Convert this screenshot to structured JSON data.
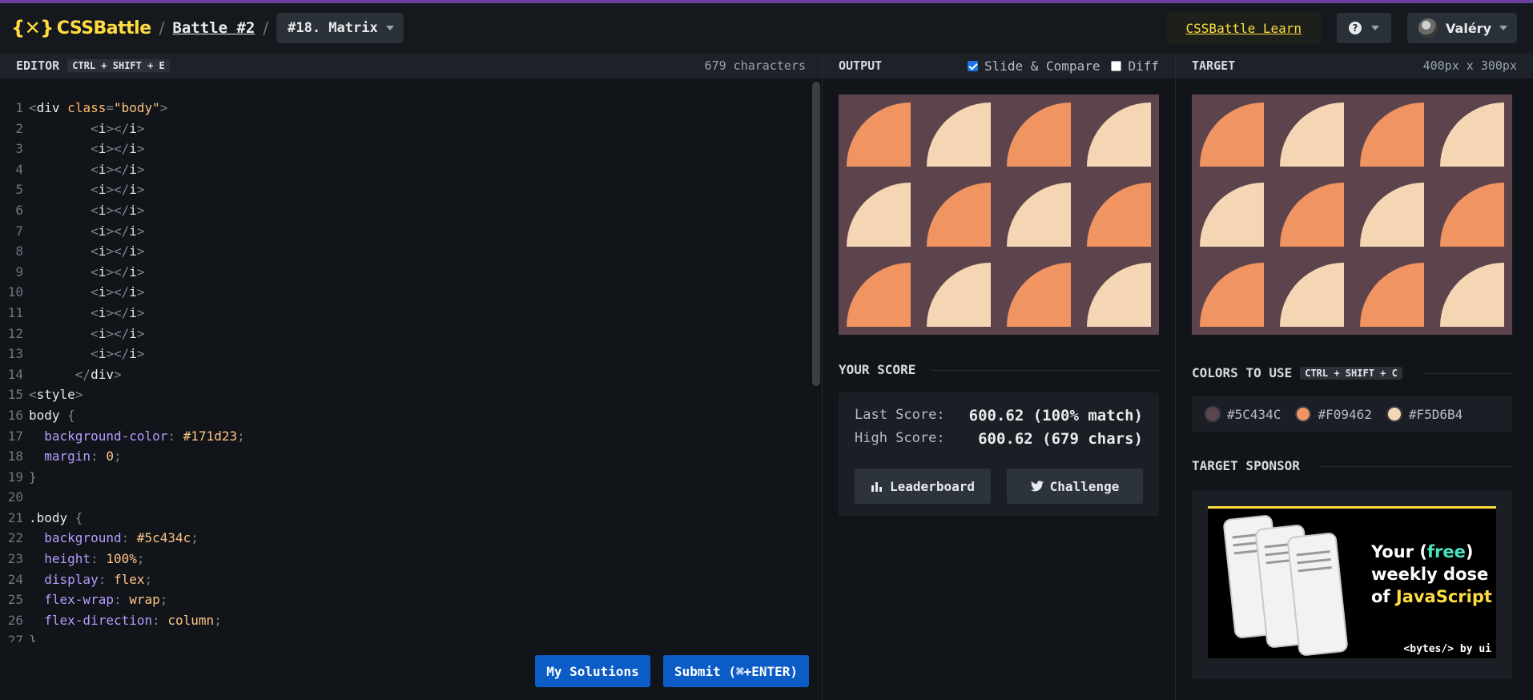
{
  "header": {
    "logo_text": "CSSBattle",
    "logo_glyph": "{✕}",
    "crumb_sep": "/",
    "battle": "Battle #2",
    "target_select": "#18. Matrix",
    "learn": "CSSBattle Learn",
    "help": "?",
    "user": "Valéry"
  },
  "editor": {
    "title": "EDITOR",
    "shortcut": "CTRL + SHIFT + E",
    "char_count": "679 characters",
    "my_solutions": "My Solutions",
    "submit": "Submit (⌘+ENTER)"
  },
  "output": {
    "title": "OUTPUT",
    "slide_compare": "Slide & Compare",
    "slide_compare_checked": true,
    "diff": "Diff",
    "diff_checked": false,
    "score_title": "YOUR SCORE",
    "last_score_label": "Last Score:",
    "last_score_value": "600.62 (100% match)",
    "high_score_label": "High Score:",
    "high_score_value": "600.62 (679 chars)",
    "leaderboard": "Leaderboard",
    "challenge": "Challenge"
  },
  "target": {
    "title": "TARGET",
    "size": "400px x 300px",
    "colors_title": "COLORS TO USE",
    "colors_shortcut": "CTRL + SHIFT + C",
    "colors": [
      {
        "hex": "#5C434C",
        "value": "#5C434C"
      },
      {
        "hex": "#F09462",
        "value": "#F09462"
      },
      {
        "hex": "#F5D6B4",
        "value": "#F5D6B4"
      }
    ],
    "sponsor_title": "TARGET SPONSOR",
    "ad_line1_a": "Your (",
    "ad_line1_free": "free",
    "ad_line1_b": ")",
    "ad_line2": "weekly dose",
    "ad_line3_a": "of ",
    "ad_line3_js": "JavaScript",
    "ad_brand": "<bytes/> by ui"
  },
  "pattern": {
    "background": "#5c434c",
    "orange": "#F09462",
    "cream": "#F5D6B4",
    "rows": [
      [
        "orange",
        "cream",
        "orange",
        "cream"
      ],
      [
        "cream",
        "orange",
        "cream",
        "orange"
      ],
      [
        "orange",
        "cream",
        "orange",
        "cream"
      ]
    ]
  },
  "code_lines": [
    [
      {
        "t": "<",
        "c": "punc"
      },
      {
        "t": "div",
        "c": "tag"
      },
      {
        "t": " class",
        "c": "attr"
      },
      {
        "t": "=",
        "c": "punc"
      },
      {
        "t": "\"body\"",
        "c": "str"
      },
      {
        "t": ">",
        "c": "punc"
      }
    ],
    [
      {
        "t": "        <",
        "c": "punc"
      },
      {
        "t": "i",
        "c": "tag"
      },
      {
        "t": "></",
        "c": "punc"
      },
      {
        "t": "i",
        "c": "tag"
      },
      {
        "t": ">",
        "c": "punc"
      }
    ],
    [
      {
        "t": "        <",
        "c": "punc"
      },
      {
        "t": "i",
        "c": "tag"
      },
      {
        "t": "></",
        "c": "punc"
      },
      {
        "t": "i",
        "c": "tag"
      },
      {
        "t": ">",
        "c": "punc"
      }
    ],
    [
      {
        "t": "        <",
        "c": "punc"
      },
      {
        "t": "i",
        "c": "tag"
      },
      {
        "t": "></",
        "c": "punc"
      },
      {
        "t": "i",
        "c": "tag"
      },
      {
        "t": ">",
        "c": "punc"
      }
    ],
    [
      {
        "t": "        <",
        "c": "punc"
      },
      {
        "t": "i",
        "c": "tag"
      },
      {
        "t": "></",
        "c": "punc"
      },
      {
        "t": "i",
        "c": "tag"
      },
      {
        "t": ">",
        "c": "punc"
      }
    ],
    [
      {
        "t": "        <",
        "c": "punc"
      },
      {
        "t": "i",
        "c": "tag"
      },
      {
        "t": "></",
        "c": "punc"
      },
      {
        "t": "i",
        "c": "tag"
      },
      {
        "t": ">",
        "c": "punc"
      }
    ],
    [
      {
        "t": "        <",
        "c": "punc"
      },
      {
        "t": "i",
        "c": "tag"
      },
      {
        "t": "></",
        "c": "punc"
      },
      {
        "t": "i",
        "c": "tag"
      },
      {
        "t": ">",
        "c": "punc"
      }
    ],
    [
      {
        "t": "        <",
        "c": "punc"
      },
      {
        "t": "i",
        "c": "tag"
      },
      {
        "t": "></",
        "c": "punc"
      },
      {
        "t": "i",
        "c": "tag"
      },
      {
        "t": ">",
        "c": "punc"
      }
    ],
    [
      {
        "t": "        <",
        "c": "punc"
      },
      {
        "t": "i",
        "c": "tag"
      },
      {
        "t": "></",
        "c": "punc"
      },
      {
        "t": "i",
        "c": "tag"
      },
      {
        "t": ">",
        "c": "punc"
      }
    ],
    [
      {
        "t": "        <",
        "c": "punc"
      },
      {
        "t": "i",
        "c": "tag"
      },
      {
        "t": "></",
        "c": "punc"
      },
      {
        "t": "i",
        "c": "tag"
      },
      {
        "t": ">",
        "c": "punc"
      }
    ],
    [
      {
        "t": "        <",
        "c": "punc"
      },
      {
        "t": "i",
        "c": "tag"
      },
      {
        "t": "></",
        "c": "punc"
      },
      {
        "t": "i",
        "c": "tag"
      },
      {
        "t": ">",
        "c": "punc"
      }
    ],
    [
      {
        "t": "        <",
        "c": "punc"
      },
      {
        "t": "i",
        "c": "tag"
      },
      {
        "t": "></",
        "c": "punc"
      },
      {
        "t": "i",
        "c": "tag"
      },
      {
        "t": ">",
        "c": "punc"
      }
    ],
    [
      {
        "t": "        <",
        "c": "punc"
      },
      {
        "t": "i",
        "c": "tag"
      },
      {
        "t": "></",
        "c": "punc"
      },
      {
        "t": "i",
        "c": "tag"
      },
      {
        "t": ">",
        "c": "punc"
      }
    ],
    [
      {
        "t": "      </",
        "c": "punc"
      },
      {
        "t": "div",
        "c": "tag"
      },
      {
        "t": ">",
        "c": "punc"
      }
    ],
    [
      {
        "t": "<",
        "c": "punc"
      },
      {
        "t": "style",
        "c": "tag"
      },
      {
        "t": ">",
        "c": "punc"
      }
    ],
    [
      {
        "t": "body ",
        "c": "sel"
      },
      {
        "t": "{",
        "c": "punc"
      }
    ],
    [
      {
        "t": "  background-color",
        "c": "prop"
      },
      {
        "t": ": ",
        "c": "punc"
      },
      {
        "t": "#171d23",
        "c": "val"
      },
      {
        "t": ";",
        "c": "punc"
      }
    ],
    [
      {
        "t": "  margin",
        "c": "prop"
      },
      {
        "t": ": ",
        "c": "punc"
      },
      {
        "t": "0",
        "c": "val"
      },
      {
        "t": ";",
        "c": "punc"
      }
    ],
    [
      {
        "t": "}",
        "c": "punc"
      }
    ],
    [],
    [
      {
        "t": ".body ",
        "c": "sel"
      },
      {
        "t": "{",
        "c": "punc"
      }
    ],
    [
      {
        "t": "  background",
        "c": "prop"
      },
      {
        "t": ": ",
        "c": "punc"
      },
      {
        "t": "#5c434c",
        "c": "val"
      },
      {
        "t": ";",
        "c": "punc"
      }
    ],
    [
      {
        "t": "  height",
        "c": "prop"
      },
      {
        "t": ": ",
        "c": "punc"
      },
      {
        "t": "100%",
        "c": "val"
      },
      {
        "t": ";",
        "c": "punc"
      }
    ],
    [
      {
        "t": "  display",
        "c": "prop"
      },
      {
        "t": ": ",
        "c": "punc"
      },
      {
        "t": "flex",
        "c": "val"
      },
      {
        "t": ";",
        "c": "punc"
      }
    ],
    [
      {
        "t": "  flex-wrap",
        "c": "prop"
      },
      {
        "t": ": ",
        "c": "punc"
      },
      {
        "t": "wrap",
        "c": "val"
      },
      {
        "t": ";",
        "c": "punc"
      }
    ],
    [
      {
        "t": "  flex-direction",
        "c": "prop"
      },
      {
        "t": ": ",
        "c": "punc"
      },
      {
        "t": "column",
        "c": "val"
      },
      {
        "t": ";",
        "c": "punc"
      }
    ],
    [
      {
        "t": "}",
        "c": "punc"
      }
    ]
  ]
}
